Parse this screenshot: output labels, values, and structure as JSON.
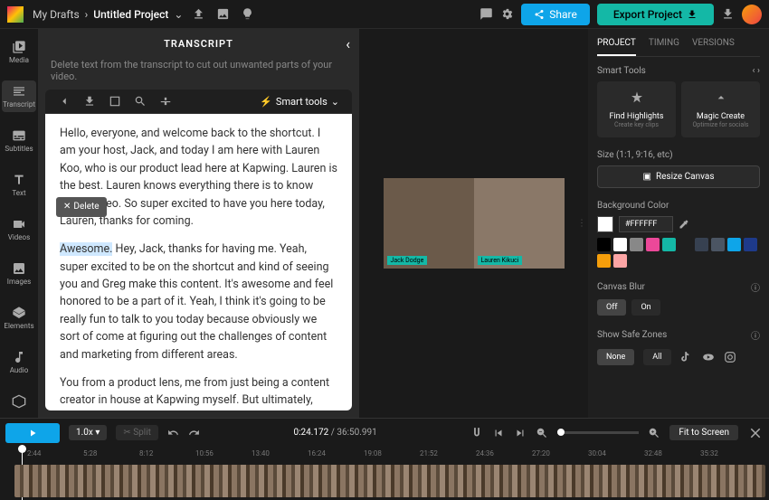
{
  "header": {
    "breadcrumb_root": "My Drafts",
    "project_name": "Untitled Project",
    "share": "Share",
    "export": "Export Project"
  },
  "sidebar": {
    "items": [
      {
        "label": "Media"
      },
      {
        "label": "Transcript"
      },
      {
        "label": "Subtitles"
      },
      {
        "label": "Text"
      },
      {
        "label": "Videos"
      },
      {
        "label": "Images"
      },
      {
        "label": "Elements"
      },
      {
        "label": "Audio"
      }
    ]
  },
  "transcript_panel": {
    "title": "TRANSCRIPT",
    "subtitle": "Delete text from the transcript to cut out unwanted parts of your video.",
    "smart_tools": "Smart tools",
    "delete_label": "Delete",
    "p1": "Hello, everyone, and welcome back to the shortcut. I am your host, Jack, and today I am here with Lauren Koo, who is our product lead here at Kapwing. Lauren is the best. Lauren knows everything there is to know about video. So super excited to have you here today, Lauren, thanks for coming.",
    "p2_hl": "Awesome.",
    "p2_rest": " Hey, Jack, thanks for having me. Yeah, super excited to be on the shortcut and kind of seeing you and Greg make this content. It's awesome and feel honored to be a part of it. Yeah, I think it's going to be really fun to talk to you today because obviously we sort of come at figuring out the challenges of content and marketing from different areas.",
    "p3": "You from a product lens, me from just being a content creator in house at Kapwing myself. But ultimately, yeah, our jobs here at Kapwing are to try to empower people to want to make video, make video accessible. And I think we both do a lot of thinking about that."
  },
  "preview": {
    "name1": "Jack Dodge",
    "name2": "Lauren Kikuci"
  },
  "right": {
    "tabs": [
      "PROJECT",
      "TIMING",
      "VERSIONS"
    ],
    "smart_tools": "Smart Tools",
    "card1_t": "Find Highlights",
    "card1_s": "Create key clips",
    "card2_t": "Magic Create",
    "card2_s": "Optimize for socials",
    "size_label": "Size (1:1, 9:16, etc)",
    "resize": "Resize Canvas",
    "bg": "Background Color",
    "hex": "#FFFFFF",
    "blur": "Canvas Blur",
    "off": "Off",
    "on": "On",
    "safe": "Show Safe Zones",
    "none": "None",
    "all": "All",
    "swatches": [
      "#000000",
      "#ffffff",
      "#888888",
      "#ec4899",
      "#14b8a6",
      "#1f1f1f",
      "#374151",
      "#4b5563",
      "#0ea5e9",
      "#1e3a8a",
      "#f59e0b",
      "#fca5a5"
    ]
  },
  "playbar": {
    "speed": "1.0x",
    "split": "Split",
    "current": "0:24.172",
    "total": "36:50.991",
    "fit": "Fit to Screen"
  },
  "timeline": {
    "ticks": [
      "2:44",
      "5:28",
      "8:12",
      "10:56",
      "13:40",
      "16:24",
      "19:08",
      "21:52",
      "24:36",
      "27:20",
      "30:04",
      "32:48",
      "35:32"
    ]
  }
}
